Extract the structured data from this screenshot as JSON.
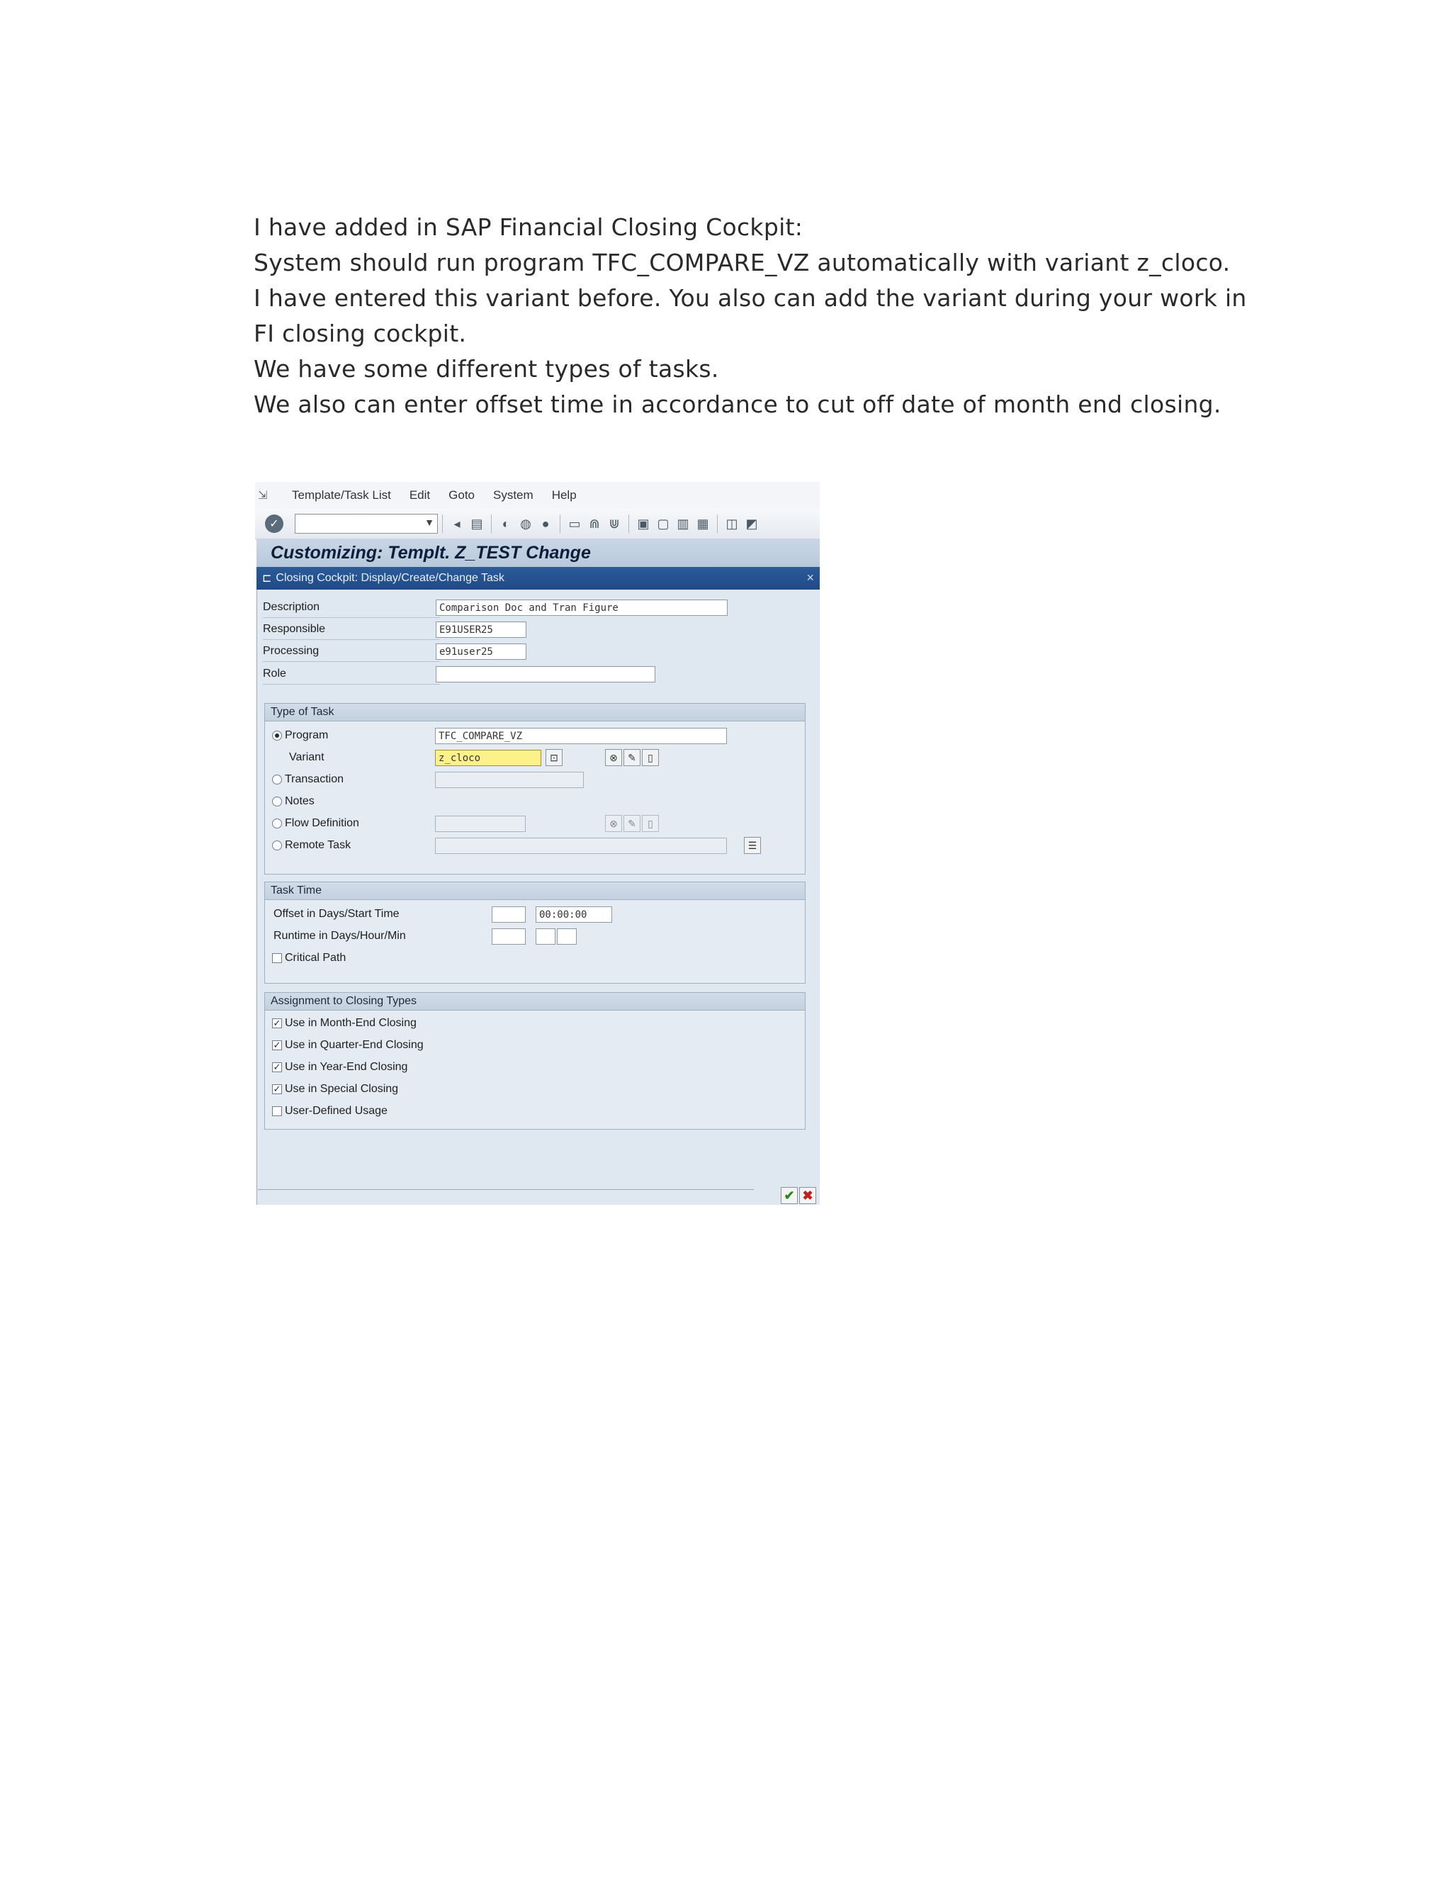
{
  "text": {
    "lines": [
      "I have added in SAP Financial Closing Cockpit:",
      "System should run program TFC_COMPARE_VZ automatically with variant z_cloco.",
      "I have entered this variant before. You also can add the variant during your work in FI closing cockpit.",
      "We have some different types of tasks.",
      "We also can enter offset time in accordance to cut off date of month end closing."
    ]
  },
  "sap": {
    "menu": [
      "Template/Task List",
      "Edit",
      "Goto",
      "System",
      "Help"
    ],
    "title": "Customizing: Templt. Z_TEST Change",
    "dialog_title": "Closing Cockpit: Display/Create/Change Task",
    "fields": {
      "description_label": "Description",
      "description_value": "Comparison Doc and Tran Figure",
      "responsible_label": "Responsible",
      "responsible_value": "E91USER25",
      "processing_label": "Processing",
      "processing_value": "e91user25",
      "role_label": "Role",
      "role_value": ""
    },
    "type_of_task": {
      "title": "Type of Task",
      "program_label": "Program",
      "program_value": "TFC_COMPARE_VZ",
      "variant_label": "Variant",
      "variant_value": "z_cloco",
      "transaction_label": "Transaction",
      "notes_label": "Notes",
      "flow_label": "Flow Definition",
      "remote_label": "Remote Task"
    },
    "task_time": {
      "title": "Task Time",
      "offset_label": "Offset in Days/Start Time",
      "offset_time": "00:00:00",
      "runtime_label": "Runtime in Days/Hour/Min",
      "critical_label": "Critical Path"
    },
    "assignment": {
      "title": "Assignment to Closing Types",
      "items": [
        {
          "label": "Use in Month-End Closing",
          "checked": true
        },
        {
          "label": "Use in Quarter-End Closing",
          "checked": true
        },
        {
          "label": "Use in Year-End Closing",
          "checked": true
        },
        {
          "label": "Use in Special Closing",
          "checked": true
        },
        {
          "label": "User-Defined Usage",
          "checked": false
        }
      ]
    },
    "icons": {
      "enter": "enter-icon",
      "ok": "check-icon",
      "cancel": "cancel-icon"
    }
  }
}
